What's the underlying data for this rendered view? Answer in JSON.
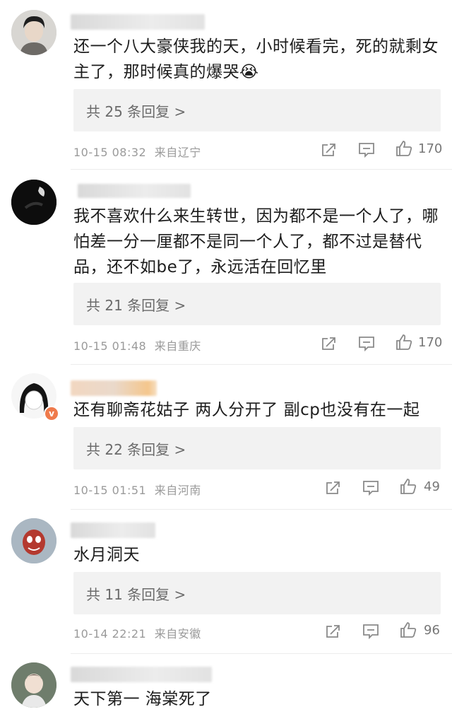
{
  "comments": [
    {
      "text": "还一个八大豪侠我的天，小时候看完，死的就剩女主了，那时候真的爆哭😭",
      "replies": "共 25 条回复 >",
      "time": "10-15 08:32",
      "location": "来自辽宁",
      "likes": "170"
    },
    {
      "text": "我不喜欢什么来生转世，因为都不是一个人了，哪怕差一分一厘都不是同一个人了，都不过是替代品，还不如be了，永远活在回忆里",
      "replies": "共 21 条回复 >",
      "time": "10-15 01:48",
      "location": "来自重庆",
      "likes": "170"
    },
    {
      "text": "还有聊斋花姑子 两人分开了 副cp也没有在一起",
      "replies": "共 22 条回复 >",
      "time": "10-15 01:51",
      "location": "来自河南",
      "likes": "49"
    },
    {
      "text": "水月洞天",
      "replies": "共 11 条回复 >",
      "time": "10-14 22:21",
      "location": "来自安徽",
      "likes": "96"
    },
    {
      "text": "天下第一 海棠死了"
    }
  ],
  "icons": {
    "share": "share-icon",
    "comment": "comment-icon",
    "like": "thumbs-up-icon",
    "verified": "verified-badge-icon"
  },
  "colors": {
    "reply_bg": "#f2f2f2",
    "meta": "#9a9a9a",
    "verified": "#ef7a4b"
  }
}
